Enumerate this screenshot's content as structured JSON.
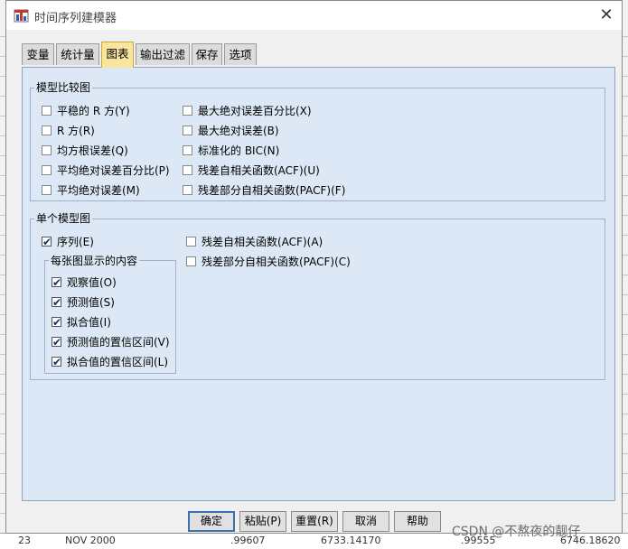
{
  "window": {
    "title": "时间序列建模器",
    "close_symbol": "✕"
  },
  "tabs": [
    {
      "label": "变量",
      "active": false
    },
    {
      "label": "统计量",
      "active": false
    },
    {
      "label": "图表",
      "active": true
    },
    {
      "label": "输出过滤",
      "active": false
    },
    {
      "label": "保存",
      "active": false
    },
    {
      "label": "选项",
      "active": false
    }
  ],
  "model_comparison": {
    "title": "模型比较图",
    "left": [
      {
        "label": "平稳的 R 方(Y)",
        "checked": false
      },
      {
        "label": "R 方(R)",
        "checked": false
      },
      {
        "label": "均方根误差(Q)",
        "checked": false
      },
      {
        "label": "平均绝对误差百分比(P)",
        "checked": false
      },
      {
        "label": "平均绝对误差(M)",
        "checked": false
      }
    ],
    "right": [
      {
        "label": "最大绝对误差百分比(X)",
        "checked": false
      },
      {
        "label": "最大绝对误差(B)",
        "checked": false
      },
      {
        "label": "标准化的 BIC(N)",
        "checked": false
      },
      {
        "label": "残差自相关函数(ACF)(U)",
        "checked": false
      },
      {
        "label": "残差部分自相关函数(PACF)(F)",
        "checked": false
      }
    ]
  },
  "single_model": {
    "title": "单个模型图",
    "series": {
      "label": "序列(E)",
      "checked": true
    },
    "per_plot": {
      "title": "每张图显示的内容",
      "items": [
        {
          "label": "观察值(O)",
          "checked": true
        },
        {
          "label": "预测值(S)",
          "checked": true
        },
        {
          "label": "拟合值(I)",
          "checked": true
        },
        {
          "label": "预测值的置信区间(V)",
          "checked": true
        },
        {
          "label": "拟合值的置信区间(L)",
          "checked": true
        }
      ]
    },
    "right": [
      {
        "label": "残差自相关函数(ACF)(A)",
        "checked": false
      },
      {
        "label": "残差部分自相关函数(PACF)(C)",
        "checked": false
      }
    ]
  },
  "buttons": [
    {
      "label": "确定",
      "default": true
    },
    {
      "label": "粘贴(P)",
      "default": false
    },
    {
      "label": "重置(R)",
      "default": false
    },
    {
      "label": "取消",
      "default": false
    },
    {
      "label": "帮助",
      "default": false
    }
  ],
  "background": {
    "row_number": "23",
    "row_date": "NOV 2000",
    "row_values": [
      ".99607",
      "6733.14170",
      ".99555",
      "6746.18620"
    ],
    "watermark": "CSDN @不熬夜的靓仔"
  },
  "colors": {
    "panel": "#dce8f5",
    "active_tab": "#f8e6a0",
    "default_button_border": "#3c6fb0",
    "check": "#1a2a6c"
  }
}
